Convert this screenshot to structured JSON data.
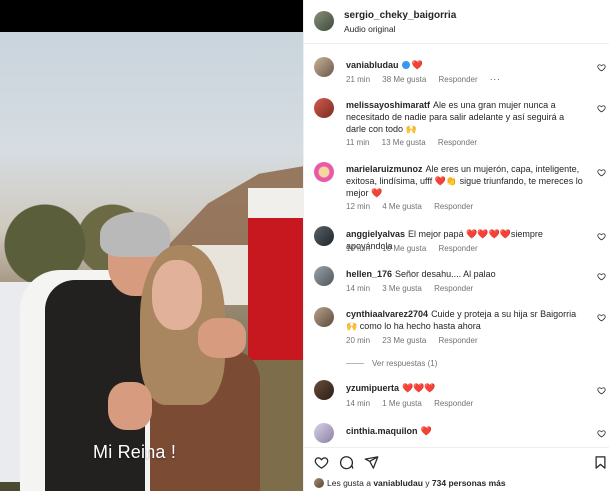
{
  "post": {
    "caption_overlay": "Mi Reina !",
    "author": "sergio_cheky_baigorria",
    "audio": "Audio original"
  },
  "comments": [
    {
      "user": "vaniabludau",
      "verified": true,
      "text": "",
      "time": "21 min",
      "likes": "38 Me gusta",
      "reply": "Responder",
      "more": "···",
      "emoji_tail": "❤️"
    },
    {
      "user": "melissayoshimaratf",
      "text": "Ale es una gran mujer nunca a necesitado de nadie para salir adelante y así seguirá a darle con todo 🙌",
      "time": "11 min",
      "likes": "13 Me gusta",
      "reply": "Responder"
    },
    {
      "user": "marielaruizmunoz",
      "text": "Ale eres un mujerón, capa, inteligente, exitosa, lindísima, ufff ❤️👏 sigue triunfando, te mereces lo mejor ❤️",
      "time": "12 min",
      "likes": "4 Me gusta",
      "reply": "Responder"
    },
    {
      "user": "anggielyalvas",
      "text": "El mejor papá ❤️❤️❤️❤️siempre apoyándola",
      "time": "10 min",
      "likes": "10 Me gusta",
      "reply": "Responder"
    },
    {
      "user": "hellen_176",
      "text": "Señor desahu.... Al palao",
      "time": "14 min",
      "likes": "3 Me gusta",
      "reply": "Responder"
    },
    {
      "user": "cynthiaalvarez2704",
      "text": "Cuide y proteja a su hija sr Baigorria 🙌 como lo ha hecho hasta ahora",
      "time": "20 min",
      "likes": "23 Me gusta",
      "reply": "Responder",
      "view_replies": "Ver respuestas (1)"
    },
    {
      "user": "yzumipuerta",
      "text": "❤️❤️❤️",
      "time": "14 min",
      "likes": "1 Me gusta",
      "reply": "Responder"
    },
    {
      "user": "cinthia.maquilon",
      "text": "❤️",
      "time": "",
      "likes": "",
      "reply": ""
    }
  ],
  "likes_summary": {
    "prefix": "Les gusta a",
    "user": "vaniabludau",
    "middle": "y",
    "others": "734 personas más"
  },
  "colors": {
    "heart": "#e0245e",
    "verified": "#3897f0",
    "muted": "#737373"
  }
}
